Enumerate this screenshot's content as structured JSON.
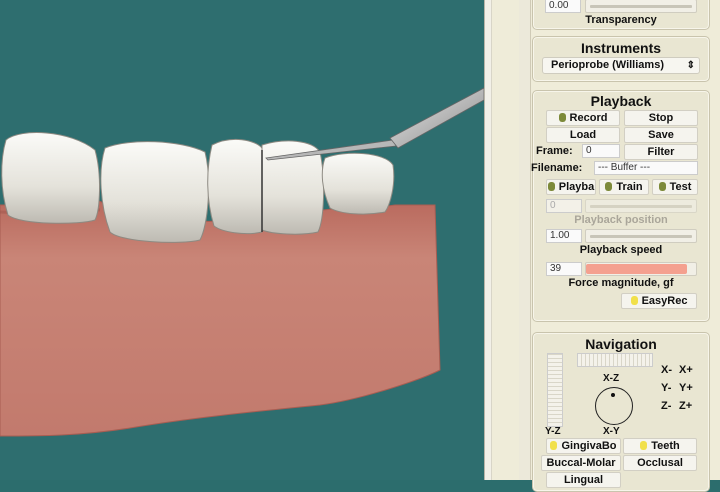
{
  "transparency": {
    "value": "0.00",
    "label": "Transparency"
  },
  "instruments": {
    "title": "Instruments",
    "selected": "Perioprobe (Williams)",
    "arrow": "⇕"
  },
  "playback": {
    "title": "Playback",
    "record": "Record",
    "stop": "Stop",
    "load": "Load",
    "save": "Save",
    "frame_label": "Frame:",
    "frame_value": "0",
    "filter": "Filter",
    "filename_label": "Filename:",
    "filename_value": "--- Buffer ---",
    "playback_btn": "Playba",
    "train_btn": "Train",
    "test_btn": "Test",
    "position_value": "0",
    "position_label": "Playback position",
    "speed_value": "1.00",
    "speed_label": "Playback speed",
    "force_value": "39",
    "force_fill": 0.92,
    "force_label": "Force magnitude, gf",
    "easyrec": "EasyRec"
  },
  "navigation": {
    "title": "Navigation",
    "xz": "X-Z",
    "xy": "X-Y",
    "yz": "Y-Z",
    "x_minus": "X-",
    "x_plus": "X+",
    "y_minus": "Y-",
    "y_plus": "Y+",
    "z_minus": "Z-",
    "z_plus": "Z+",
    "gingiva": "GingivaBo",
    "teeth": "Teeth",
    "buccal_molar": "Buccal-Molar",
    "occlusal": "Occlusal",
    "lingual": "Lingual"
  },
  "colors": {
    "background": "#2e6e6f",
    "gingiva": "#c97b6d",
    "force_bar": "#f4a08f",
    "led_on": "#f1e04a",
    "led_off": "#7d8a3a"
  }
}
